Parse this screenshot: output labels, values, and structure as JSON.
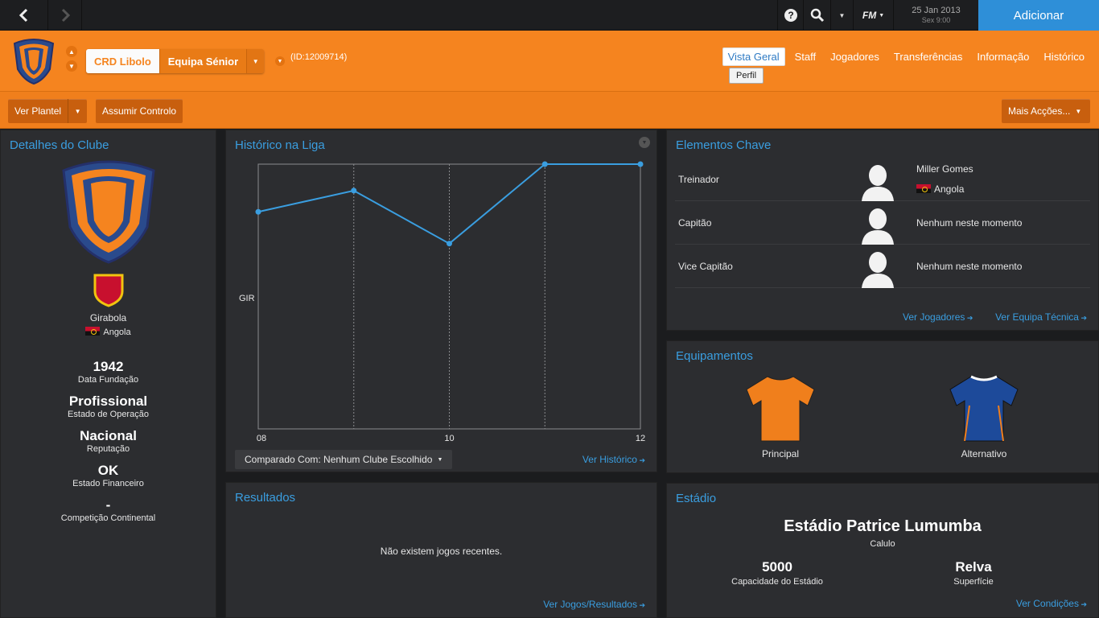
{
  "topbar": {
    "date": "25 Jan 2013",
    "day": "Sex 9:00",
    "add_label": "Adicionar",
    "fm_label": "FM"
  },
  "header": {
    "club_name": "CRD Libolo",
    "team": "Equipa Sénior",
    "club_id": "(ID:12009714)",
    "tabs": [
      "Vista Geral",
      "Staff",
      "Jogadores",
      "Transferências",
      "Informação",
      "Histórico"
    ],
    "subtab": "Perfil"
  },
  "toolbar": {
    "squad": "Ver Plantel",
    "control": "Assumir Controlo",
    "more": "Mais Acções..."
  },
  "club_details": {
    "title": "Detalhes do Clube",
    "league": "Girabola",
    "country": "Angola",
    "stats": [
      {
        "value": "1942",
        "label": "Data Fundação"
      },
      {
        "value": "Profissional",
        "label": "Estado de Operação"
      },
      {
        "value": "Nacional",
        "label": "Reputação"
      },
      {
        "value": "OK",
        "label": "Estado Financeiro"
      },
      {
        "value": "-",
        "label": "Competição Continental"
      }
    ]
  },
  "league_history": {
    "title": "Histórico na Liga",
    "compare": "Comparado Com: Nenhum Clube Escolhido",
    "link": "Ver Histórico"
  },
  "chart_data": {
    "type": "line",
    "x": [
      "08",
      "09",
      "10",
      "11",
      "12"
    ],
    "x_tick_labels": [
      "08",
      "10",
      "12"
    ],
    "ylabel_tick": "GIR",
    "values": [
      0.82,
      0.9,
      0.7,
      1.0,
      1.0
    ],
    "ylim": [
      0,
      1
    ],
    "color": "#3a9ee0"
  },
  "results": {
    "title": "Resultados",
    "empty": "Não existem jogos recentes.",
    "link": "Ver Jogos/Resultados"
  },
  "key_people": {
    "title": "Elementos Chave",
    "rows": [
      {
        "role": "Treinador",
        "name": "Miller Gomes",
        "nation": "Angola"
      },
      {
        "role": "Capitão",
        "name": "Nenhum neste momento"
      },
      {
        "role": "Vice Capitão",
        "name": "Nenhum neste momento"
      }
    ],
    "link_players": "Ver Jogadores",
    "link_staff": "Ver Equipa Técnica"
  },
  "kits": {
    "title": "Equipamentos",
    "home": "Principal",
    "away": "Alternativo",
    "home_color": "#f07f1c",
    "away_color": "#1d4a9a"
  },
  "stadium": {
    "title": "Estádio",
    "name": "Estádio Patrice Lumumba",
    "city": "Calulo",
    "capacity": "5000",
    "capacity_label": "Capacidade do Estádio",
    "surface": "Relva",
    "surface_label": "Superfície",
    "link": "Ver Condições"
  }
}
